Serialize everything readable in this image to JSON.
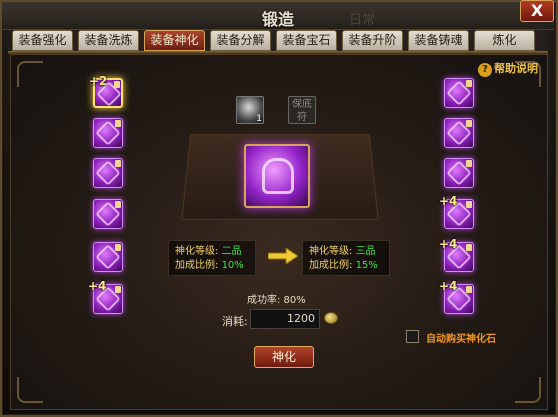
{
  "window": {
    "title": "锻造",
    "ghost_text": "日常",
    "close_label": "X"
  },
  "tabs": [
    {
      "label": "装备强化",
      "active": false
    },
    {
      "label": "装备洗炼",
      "active": false
    },
    {
      "label": "装备神化",
      "active": true
    },
    {
      "label": "装备分解",
      "active": false
    },
    {
      "label": "装备宝石",
      "active": false
    },
    {
      "label": "装备升阶",
      "active": false
    },
    {
      "label": "装备铸魂",
      "active": false
    },
    {
      "label": "炼化",
      "active": false
    }
  ],
  "help": {
    "label": "帮助说明"
  },
  "materials": {
    "stone_count": "1",
    "charm_label": "保底\n符"
  },
  "left_slots": [
    {
      "level": "+2",
      "selected": true,
      "icon": "armor-icon"
    },
    {
      "level": "",
      "selected": false,
      "icon": "belt-icon"
    },
    {
      "level": "",
      "selected": false,
      "icon": "boots-icon"
    },
    {
      "level": "",
      "selected": false,
      "icon": "bracer-icon"
    },
    {
      "level": "",
      "selected": false,
      "icon": "gloves-icon"
    },
    {
      "level": "+4",
      "selected": false,
      "icon": "ring-icon"
    }
  ],
  "right_slots": [
    {
      "level": "",
      "icon": "sword-icon"
    },
    {
      "level": "",
      "icon": "necklace-icon"
    },
    {
      "level": "",
      "icon": "cape-icon"
    },
    {
      "level": "+4",
      "icon": "spear-icon"
    },
    {
      "level": "+4",
      "icon": "axe-icon"
    },
    {
      "level": "+4",
      "icon": "staff-icon"
    }
  ],
  "current": {
    "level_key": "神化等级:",
    "level_val": "二品",
    "ratio_key": "加成比例:",
    "ratio_val": "10%"
  },
  "next": {
    "level_key": "神化等级:",
    "level_val": "三品",
    "ratio_key": "加成比例:",
    "ratio_val": "15%"
  },
  "success_rate": "成功率: 80%",
  "cost": {
    "label": "消耗:",
    "value": "1200"
  },
  "auto_buy": {
    "label": "自动购买神化石",
    "checked": false
  },
  "action_button": "神化",
  "colors": {
    "accent_gold": "#f0d066",
    "value_green": "#42e04a",
    "epic_purple": "#9424c9",
    "tab_active": "#a9452d"
  }
}
